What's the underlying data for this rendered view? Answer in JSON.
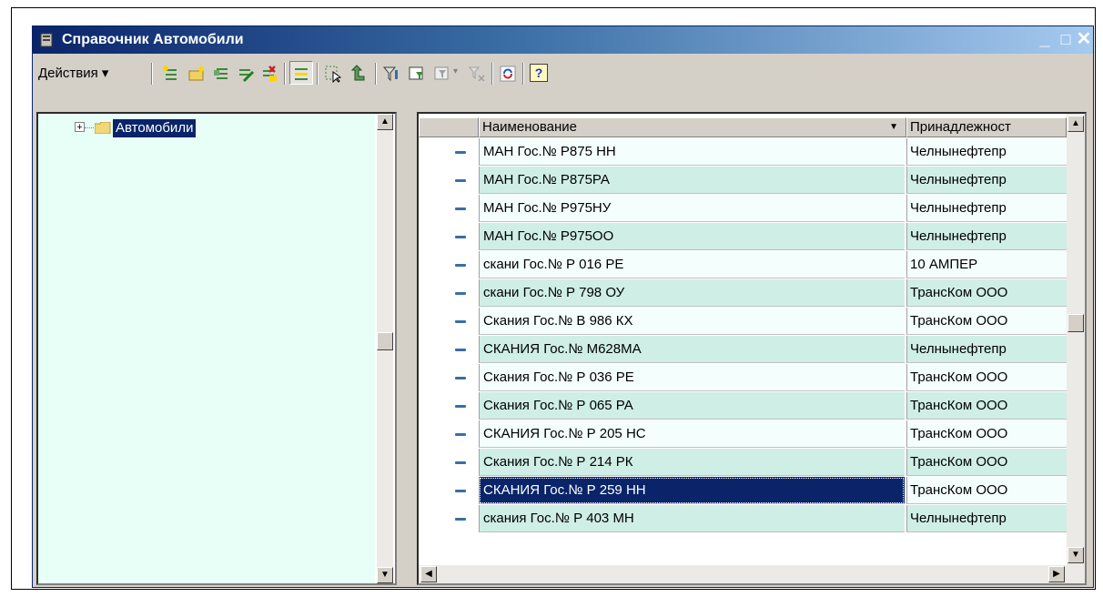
{
  "window": {
    "title": "Справочник Автомобили",
    "minimize": "_",
    "maximize": "□",
    "close": "✕"
  },
  "toolbar": {
    "actions_label": "Действия ▾",
    "help_label": "?"
  },
  "tree": {
    "root_label": "Автомобили",
    "expander": "⊞"
  },
  "table": {
    "columns": [
      "Наименование",
      "Принадлежност"
    ],
    "header_dropdown": "▼",
    "rows": [
      {
        "name": "МАН Гос.№ Р875 НН",
        "owner": "Челнынефтепр"
      },
      {
        "name": "МАН Гос.№ Р875РА",
        "owner": "Челнынефтепр"
      },
      {
        "name": "МАН Гос.№ Р975НУ",
        "owner": "Челнынефтепр"
      },
      {
        "name": "МАН Гос.№ Р975ОО",
        "owner": "Челнынефтепр"
      },
      {
        "name": "скани Гос.№ Р 016 РЕ",
        "owner": "10 АМПЕР"
      },
      {
        "name": "скани Гос.№ Р 798 ОУ",
        "owner": "ТрансКом ООО"
      },
      {
        "name": "Скания Гос.№ В 986 КХ",
        "owner": "ТрансКом ООО"
      },
      {
        "name": "СКАНИЯ Гос.№ М628МА",
        "owner": "Челнынефтепр"
      },
      {
        "name": "Скания Гос.№ Р 036 РЕ",
        "owner": "ТрансКом ООО"
      },
      {
        "name": "Скания Гос.№ Р 065 РА",
        "owner": "ТрансКом ООО"
      },
      {
        "name": "СКАНИЯ Гос.№ Р 205 НС",
        "owner": "ТрансКом ООО"
      },
      {
        "name": "Скания Гос.№ Р 214 РК",
        "owner": "ТрансКом ООО"
      },
      {
        "name": "СКАНИЯ Гос.№ Р 259 НН",
        "owner": "ТрансКом ООО"
      },
      {
        "name": "скания Гос.№ Р 403 МН",
        "owner": "Челнынефтепр"
      }
    ],
    "selected_index": 12
  },
  "scroll": {
    "up": "▲",
    "down": "▼",
    "left": "◀",
    "right": "▶"
  },
  "colors": {
    "selection": "#0a246a",
    "row_even": "#f4fffd",
    "row_odd": "#cfeee6",
    "tree_bg": "#e8fff8"
  }
}
